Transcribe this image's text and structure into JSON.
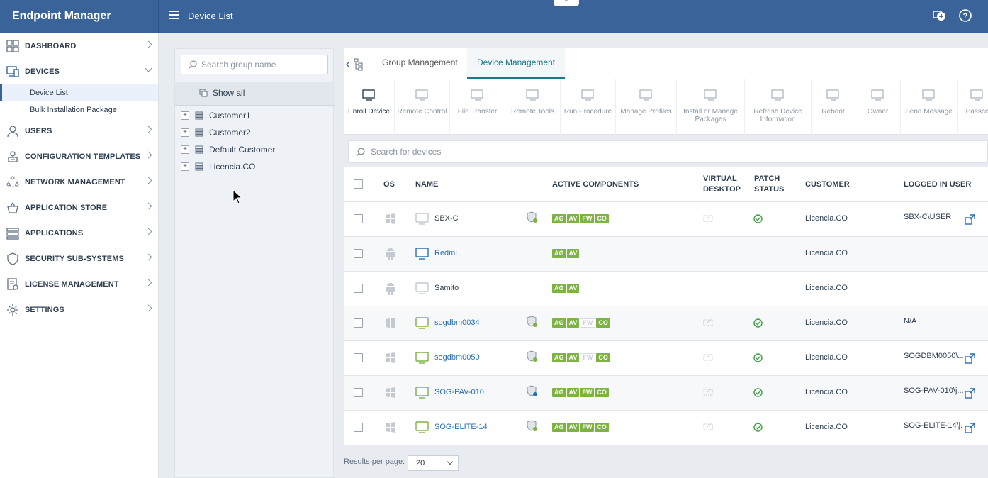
{
  "app": {
    "title": "Endpoint Manager",
    "page_title": "Device List"
  },
  "sidebar": {
    "items": [
      {
        "label": "DASHBOARD",
        "icon": "dashboard-icon"
      },
      {
        "label": "DEVICES",
        "icon": "devices-icon",
        "expanded": true
      },
      {
        "label": "USERS",
        "icon": "users-icon"
      },
      {
        "label": "CONFIGURATION TEMPLATES",
        "icon": "templates-icon"
      },
      {
        "label": "NETWORK MANAGEMENT",
        "icon": "network-icon"
      },
      {
        "label": "APPLICATION STORE",
        "icon": "store-icon"
      },
      {
        "label": "APPLICATIONS",
        "icon": "applications-icon"
      },
      {
        "label": "SECURITY SUB-SYSTEMS",
        "icon": "shield-icon"
      },
      {
        "label": "LICENSE MANAGEMENT",
        "icon": "license-icon"
      },
      {
        "label": "SETTINGS",
        "icon": "gear-icon"
      }
    ],
    "sub_items": [
      {
        "label": "Device List",
        "active": true
      },
      {
        "label": "Bulk Installation Package"
      }
    ]
  },
  "groups": {
    "search_placeholder": "Search group name",
    "show_all": "Show all",
    "tree": [
      "Customer1",
      "Customer2",
      "Default Customer",
      "Licencia.CO"
    ]
  },
  "tabs": [
    "Group Management",
    "Device Management"
  ],
  "toolbar": [
    "Enroll Device",
    "Remote Control",
    "File Transfer",
    "Remote Tools",
    "Run Procedure",
    "Manage Profiles",
    "Install or Manage Packages",
    "Refresh Device Information",
    "Reboot",
    "Owner",
    "Send Message",
    "Passco"
  ],
  "device_search_placeholder": "Search for devices",
  "table": {
    "headers": {
      "os": "OS",
      "name": "NAME",
      "components": "ACTIVE COMPONENTS",
      "virtual_desktop": "VIRTUAL DESKTOP",
      "patch_status": "PATCH STATUS",
      "customer": "CUSTOMER",
      "logged_in_user": "LOGGED IN USER"
    },
    "rows": [
      {
        "os": "windows",
        "name": "SBX-C",
        "link": false,
        "shield": true,
        "components": [
          "AG",
          "AV",
          "FW",
          "CO"
        ],
        "off": [],
        "vd": true,
        "patch": true,
        "customer": "Licencia.CO",
        "user": "SBX-C\\USER",
        "remote": true
      },
      {
        "os": "android",
        "name": "Redmi",
        "link": true,
        "shield": false,
        "components": [
          "AG",
          "AV"
        ],
        "off": [],
        "vd": false,
        "patch": false,
        "customer": "Licencia.CO",
        "user": "",
        "remote": false
      },
      {
        "os": "android",
        "name": "Samito",
        "link": false,
        "shield": false,
        "components": [
          "AG",
          "AV"
        ],
        "off": [],
        "vd": false,
        "patch": false,
        "customer": "Licencia.CO",
        "user": "",
        "remote": false
      },
      {
        "os": "windows",
        "name": "sogdbm0034",
        "link": true,
        "shield": true,
        "components": [
          "AG",
          "AV",
          "FW",
          "CO"
        ],
        "off": [
          "FW"
        ],
        "vd": true,
        "patch": true,
        "customer": "Licencia.CO",
        "user": "N/A",
        "remote": false
      },
      {
        "os": "windows",
        "name": "sogdbm0050",
        "link": true,
        "shield": true,
        "components": [
          "AG",
          "AV",
          "FW",
          "CO"
        ],
        "off": [
          "FW"
        ],
        "vd": true,
        "patch": true,
        "customer": "Licencia.CO",
        "user": "SOGDBM0050\\...",
        "remote": true
      },
      {
        "os": "windows",
        "name": "SOG-PAV-010",
        "link": true,
        "shield": true,
        "components": [
          "AG",
          "AV",
          "FW",
          "CO"
        ],
        "off": [],
        "vd": true,
        "patch": true,
        "customer": "Licencia.CO",
        "user": "SOG-PAV-010\\j...",
        "remote": true
      },
      {
        "os": "windows",
        "name": "SOG-ELITE-14",
        "link": true,
        "shield": true,
        "components": [
          "AG",
          "AV",
          "FW",
          "CO"
        ],
        "off": [],
        "vd": true,
        "patch": true,
        "customer": "Licencia.CO",
        "user": "SOG-ELITE-14\\j...",
        "remote": true
      }
    ]
  },
  "footer": {
    "results_label": "Results per page:",
    "results_value": "20"
  }
}
